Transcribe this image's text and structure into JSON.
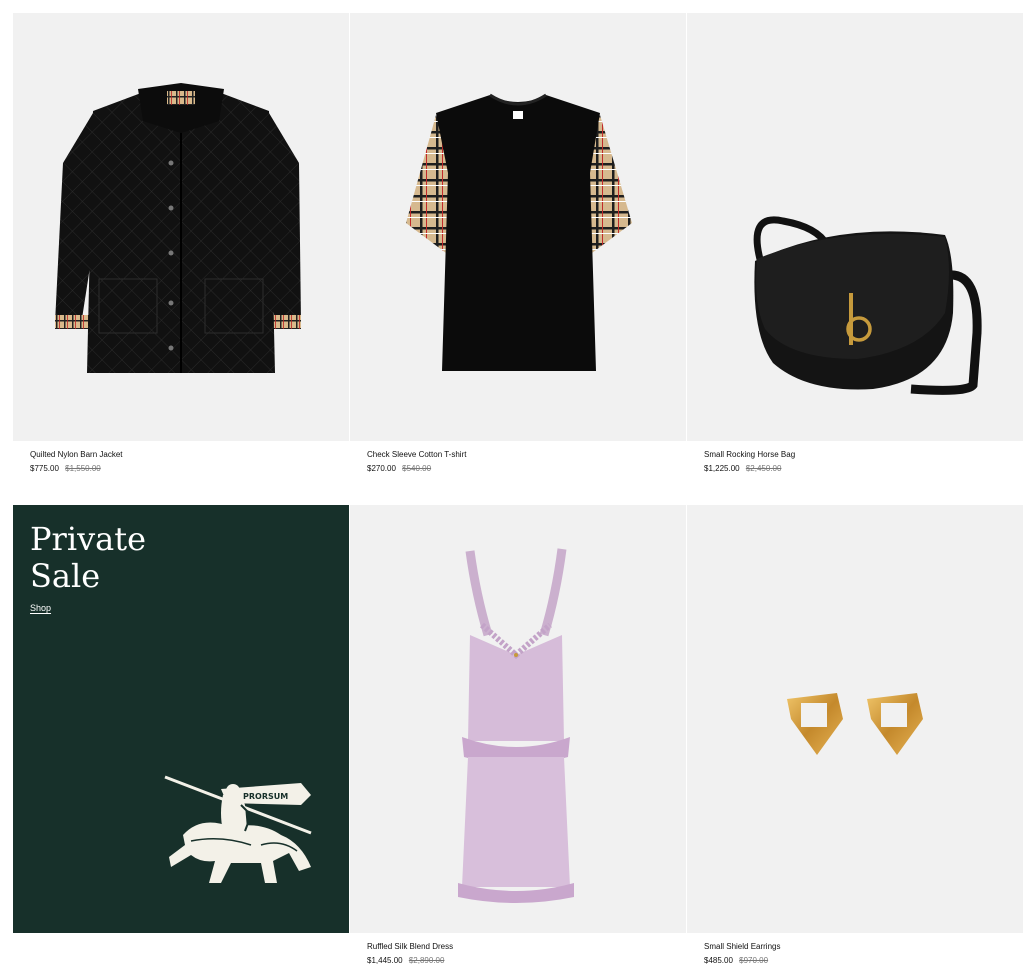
{
  "products": [
    {
      "name": "Quilted Nylon Barn Jacket",
      "price": "$775.00",
      "original_price": "$1,550.00",
      "image_icon": "quilted-jacket"
    },
    {
      "name": "Check Sleeve Cotton T-shirt",
      "price": "$270.00",
      "original_price": "$540.00",
      "image_icon": "check-sleeve-tshirt"
    },
    {
      "name": "Small Rocking Horse Bag",
      "price": "$1,225.00",
      "original_price": "$2,450.00",
      "image_icon": "shoulder-bag"
    },
    {
      "name": "Ruffled Silk Blend Dress",
      "price": "$1,445.00",
      "original_price": "$2,890.00",
      "image_icon": "ruffled-dress"
    },
    {
      "name": "Small Shield Earrings",
      "price": "$485.00",
      "original_price": "$970.00",
      "image_icon": "shield-earrings"
    }
  ],
  "promo": {
    "title": "Private\nSale",
    "link_label": "Shop",
    "logo_text": "PRORSUM",
    "background": "#17302a"
  },
  "colors": {
    "photo_background": "#f1f1f1",
    "original_price": "#777777"
  }
}
